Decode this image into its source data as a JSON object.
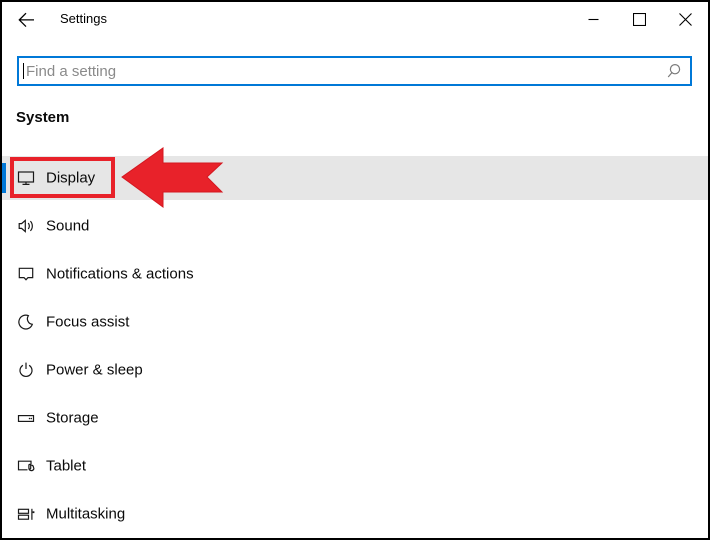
{
  "titlebar": {
    "title": "Settings",
    "back_icon": "back-arrow",
    "controls": [
      "minimize",
      "maximize",
      "close"
    ]
  },
  "search": {
    "placeholder": "Find a setting",
    "icon": "magnifier",
    "border_color": "#0078d7"
  },
  "section_heading": "System",
  "nav_items": [
    {
      "label": "Display",
      "icon": "monitor-icon",
      "selected": true
    },
    {
      "label": "Sound",
      "icon": "speaker-icon",
      "selected": false
    },
    {
      "label": "Notifications & actions",
      "icon": "speech-bubble-icon",
      "selected": false
    },
    {
      "label": "Focus assist",
      "icon": "crescent-moon-icon",
      "selected": false
    },
    {
      "label": "Power & sleep",
      "icon": "power-icon",
      "selected": false
    },
    {
      "label": "Storage",
      "icon": "drive-icon",
      "selected": false
    },
    {
      "label": "Tablet",
      "icon": "tablet-touch-icon",
      "selected": false
    },
    {
      "label": "Multitasking",
      "icon": "multitask-panes-icon",
      "selected": false
    }
  ],
  "annotations": {
    "highlighted_item": "Display",
    "shape_1": "red rectangle around Display item",
    "shape_2": "red swallow-tail arrow pointing left at Display",
    "color": "#e8222a"
  },
  "colors": {
    "accent_blue": "#0078d7",
    "selected_row_bg": "#e6e6e6",
    "window_border": "#000000"
  }
}
